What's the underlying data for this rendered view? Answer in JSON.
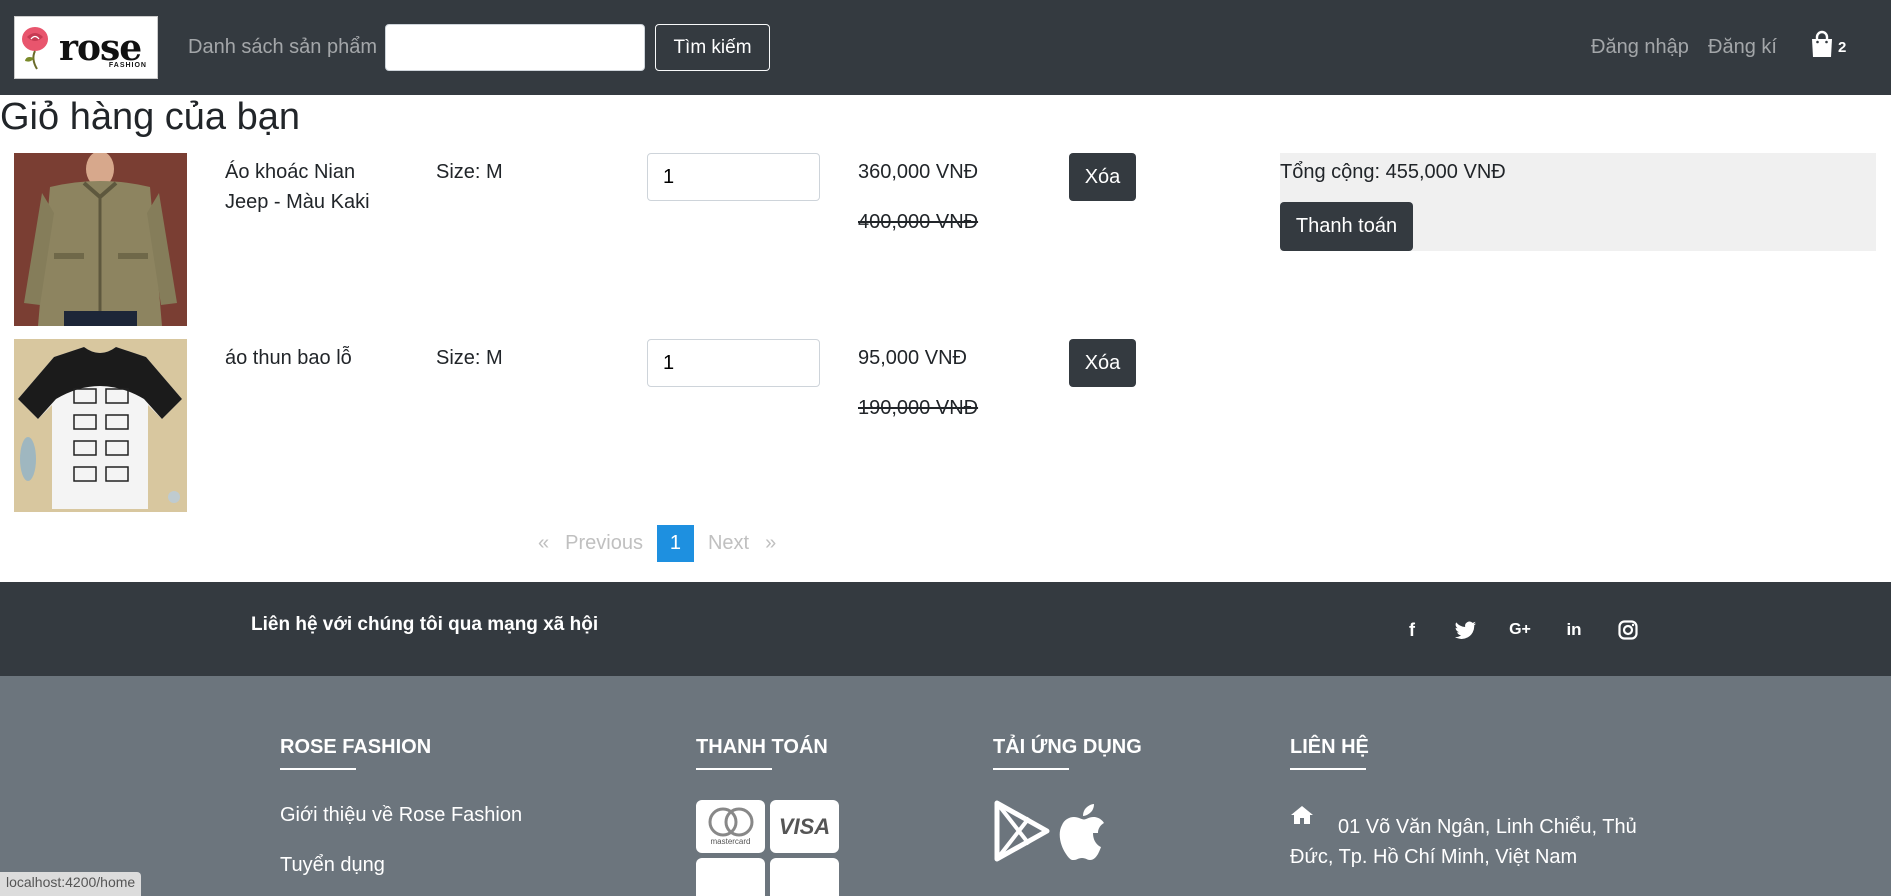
{
  "header": {
    "logo_text": "rose",
    "logo_sub": "FASHION",
    "product_list_link": "Danh sách sản phẩm",
    "search": {
      "value": "",
      "placeholder": ""
    },
    "search_button": "Tìm kiếm",
    "login_link": "Đăng nhập",
    "register_link": "Đăng kí",
    "cart_count": "2"
  },
  "page_title": "Giỏ hàng của bạn",
  "cart_items": [
    {
      "name": "Áo khoác Nian Jeep - Màu Kaki",
      "size": "Size: M",
      "quantity": "1",
      "price": "360,000 VNĐ",
      "original_price": "400,000 VNĐ",
      "delete_label": "Xóa"
    },
    {
      "name": "áo thun bao lỗ",
      "size": "Size: M",
      "quantity": "1",
      "price": "95,000 VNĐ",
      "original_price": "190,000 VNĐ",
      "delete_label": "Xóa"
    }
  ],
  "summary": {
    "total": "Tổng cộng: 455,000 VNĐ",
    "checkout_button": "Thanh toán"
  },
  "pagination": {
    "prev_arrow": "«",
    "prev": "Previous",
    "current": "1",
    "next": "Next",
    "next_arrow": "»"
  },
  "social": {
    "text": "Liên hệ với chúng tôi qua mạng xã hội",
    "icons": [
      "facebook-icon",
      "twitter-icon",
      "google-plus-icon",
      "linkedin-icon",
      "instagram-icon"
    ],
    "labels": {
      "facebook": "f",
      "google_plus": "G+",
      "linkedin": "in"
    }
  },
  "footer": {
    "col1": {
      "heading": "ROSE FASHION",
      "links": [
        "Giới thiệu về Rose Fashion",
        "Tuyển dụng"
      ]
    },
    "col2": {
      "heading": "THANH TOÁN",
      "cards": [
        "mastercard",
        "VISA"
      ]
    },
    "col3": {
      "heading": "TẢI ỨNG DỤNG",
      "apps": [
        "google-play-icon",
        "apple-icon"
      ]
    },
    "col4": {
      "heading": "LIÊN HỆ",
      "address": "01 Võ Văn Ngân, Linh Chiểu, Thủ Đức, Tp. Hồ Chí Minh, Việt Nam"
    }
  },
  "status_bar_url": "localhost:4200/home",
  "colors": {
    "navbar": "#343a40",
    "footer": "#6c757d",
    "page_active": "#1e90e0"
  }
}
